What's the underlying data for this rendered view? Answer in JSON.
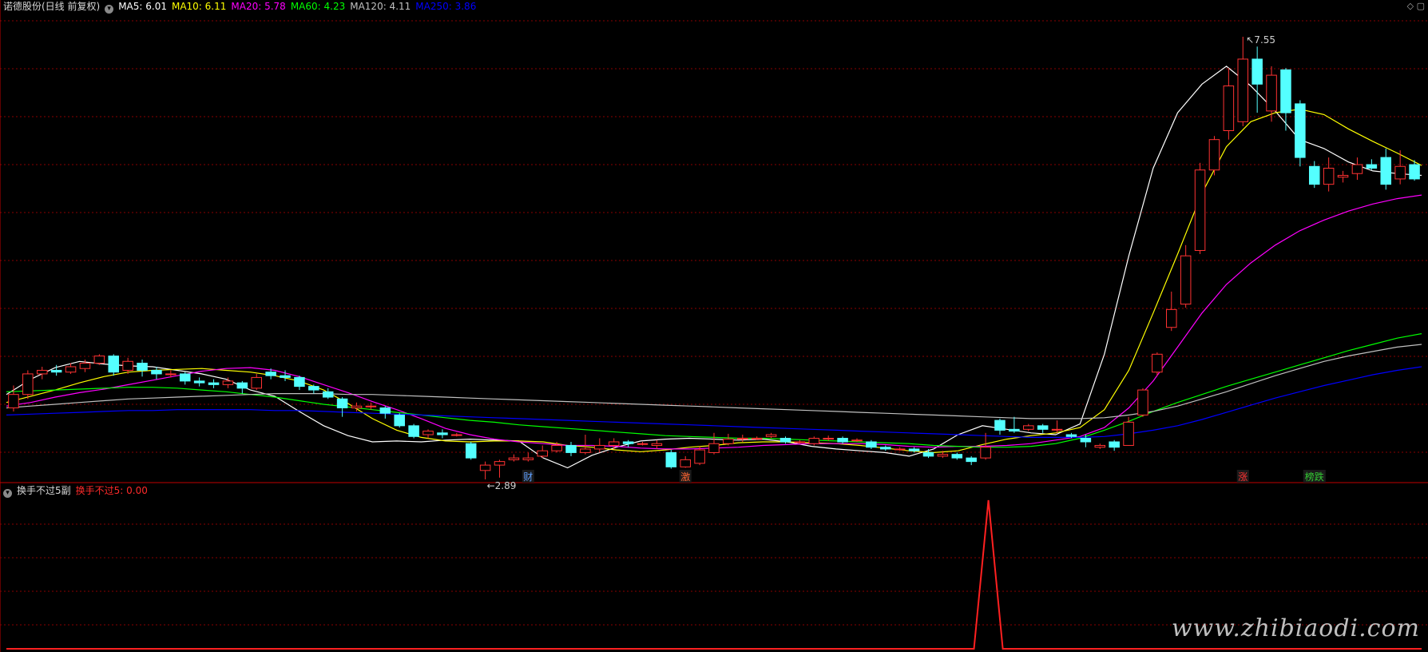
{
  "header": {
    "stock_title": "诺德股份(日线 前复权)",
    "ma_items": [
      {
        "label": "MA5: 6.01",
        "color": "#ffffff"
      },
      {
        "label": "MA10: 6.11",
        "color": "#ffff00"
      },
      {
        "label": "MA20: 5.78",
        "color": "#ff00ff"
      },
      {
        "label": "MA60: 4.23",
        "color": "#00ff00"
      },
      {
        "label": "MA120: 4.11",
        "color": "#c0c0c0"
      },
      {
        "label": "MA250: 3.86",
        "color": "#0000ff"
      }
    ]
  },
  "sub_header": {
    "indicator_name": "换手不过5副",
    "indicator_value": "换手不过5: 0.00",
    "value_color": "#ff2a2a"
  },
  "annotations": {
    "high_label": "7.55",
    "low_label": "2.89",
    "marks": [
      {
        "text": "财",
        "color": "#5fa0ff"
      },
      {
        "text": "激",
        "color": "#ff6633"
      },
      {
        "text": "涨",
        "color": "#ff3333"
      },
      {
        "text": "榜跌",
        "color": "#33cc33"
      }
    ]
  },
  "watermark": "www.zhibiaodi.com",
  "chart_data": [
    {
      "type": "candlestick",
      "title": "诺德股份(日线 前复权)",
      "ylim": [
        2.6,
        7.8
      ],
      "grid": true,
      "candles": [
        [
          3.4,
          3.55,
          3.65,
          3.36
        ],
        [
          3.55,
          3.78,
          3.82,
          3.5
        ],
        [
          3.78,
          3.82,
          3.86,
          3.72
        ],
        [
          3.82,
          3.8,
          3.88,
          3.76
        ],
        [
          3.8,
          3.86,
          3.9,
          3.78
        ],
        [
          3.84,
          3.9,
          3.94,
          3.8
        ],
        [
          3.9,
          3.98,
          4.0,
          3.88
        ],
        [
          3.98,
          3.8,
          4.0,
          3.76
        ],
        [
          3.82,
          3.92,
          3.96,
          3.78
        ],
        [
          3.9,
          3.82,
          3.94,
          3.75
        ],
        [
          3.82,
          3.78,
          3.86,
          3.72
        ],
        [
          3.78,
          3.78,
          3.82,
          3.74
        ],
        [
          3.78,
          3.7,
          3.8,
          3.66
        ],
        [
          3.7,
          3.68,
          3.74,
          3.64
        ],
        [
          3.68,
          3.66,
          3.72,
          3.62
        ],
        [
          3.66,
          3.7,
          3.74,
          3.62
        ],
        [
          3.68,
          3.62,
          3.7,
          3.56
        ],
        [
          3.62,
          3.74,
          3.78,
          3.6
        ],
        [
          3.8,
          3.76,
          3.84,
          3.72
        ],
        [
          3.76,
          3.74,
          3.82,
          3.7
        ],
        [
          3.74,
          3.64,
          3.76,
          3.6
        ],
        [
          3.64,
          3.6,
          3.66,
          3.56
        ],
        [
          3.58,
          3.52,
          3.62,
          3.5
        ],
        [
          3.5,
          3.4,
          3.52,
          3.3
        ],
        [
          3.4,
          3.42,
          3.46,
          3.36
        ],
        [
          3.42,
          3.42,
          3.46,
          3.38
        ],
        [
          3.4,
          3.34,
          3.42,
          3.28
        ],
        [
          3.32,
          3.2,
          3.34,
          3.18
        ],
        [
          3.2,
          3.08,
          3.22,
          3.06
        ],
        [
          3.1,
          3.14,
          3.16,
          3.06
        ],
        [
          3.12,
          3.1,
          3.16,
          3.06
        ],
        [
          3.1,
          3.1,
          3.12,
          3.08
        ],
        [
          3.0,
          2.84,
          3.02,
          2.82
        ],
        [
          2.7,
          2.76,
          2.8,
          2.6
        ],
        [
          2.76,
          2.8,
          2.82,
          2.62
        ],
        [
          2.82,
          2.84,
          2.88,
          2.8
        ],
        [
          2.82,
          2.84,
          2.9,
          2.8
        ],
        [
          2.86,
          2.92,
          2.98,
          2.84
        ],
        [
          2.92,
          2.98,
          3.02,
          2.9
        ],
        [
          2.98,
          2.9,
          3.02,
          2.86
        ],
        [
          2.9,
          2.94,
          3.1,
          2.88
        ],
        [
          2.94,
          2.98,
          3.06,
          2.9
        ],
        [
          2.98,
          3.02,
          3.06,
          2.94
        ],
        [
          3.02,
          3.0,
          3.04,
          2.96
        ],
        [
          3.0,
          3.0,
          3.02,
          2.98
        ],
        [
          2.98,
          3.0,
          3.04,
          2.94
        ],
        [
          2.9,
          2.74,
          2.93,
          2.72
        ],
        [
          2.74,
          2.82,
          2.86,
          2.73
        ],
        [
          2.78,
          2.93,
          2.97,
          2.76
        ],
        [
          2.9,
          3.0,
          3.12,
          2.88
        ],
        [
          3.0,
          3.05,
          3.11,
          2.98
        ],
        [
          3.05,
          3.06,
          3.1,
          3.02
        ],
        [
          3.06,
          3.06,
          3.08,
          3.04
        ],
        [
          3.08,
          3.1,
          3.12,
          3.06
        ],
        [
          3.06,
          3.02,
          3.08,
          3.0
        ],
        [
          3.02,
          3.02,
          3.04,
          3.0
        ],
        [
          3.0,
          3.06,
          3.08,
          2.98
        ],
        [
          3.06,
          3.06,
          3.09,
          3.03
        ],
        [
          3.06,
          3.02,
          3.08,
          3.0
        ],
        [
          3.04,
          3.04,
          3.06,
          3.02
        ],
        [
          3.02,
          2.96,
          3.04,
          2.94
        ],
        [
          2.96,
          2.94,
          2.98,
          2.92
        ],
        [
          2.94,
          2.94,
          2.96,
          2.92
        ],
        [
          2.94,
          2.92,
          2.96,
          2.9
        ],
        [
          2.9,
          2.86,
          2.94,
          2.84
        ],
        [
          2.86,
          2.88,
          2.92,
          2.84
        ],
        [
          2.88,
          2.84,
          2.9,
          2.82
        ],
        [
          2.84,
          2.8,
          2.86,
          2.76
        ],
        [
          2.84,
          2.96,
          3.12,
          2.82
        ],
        [
          3.26,
          3.15,
          3.28,
          3.1
        ],
        [
          3.16,
          3.14,
          3.3,
          3.12
        ],
        [
          3.16,
          3.2,
          3.22,
          3.14
        ],
        [
          3.2,
          3.16,
          3.22,
          3.12
        ],
        [
          3.16,
          3.16,
          3.26,
          3.12
        ],
        [
          3.1,
          3.08,
          3.12,
          3.06
        ],
        [
          3.06,
          3.02,
          3.1,
          2.96
        ],
        [
          2.96,
          2.98,
          3.0,
          2.94
        ],
        [
          3.02,
          2.96,
          3.04,
          2.92
        ],
        [
          2.98,
          3.24,
          3.3,
          2.98
        ],
        [
          3.32,
          3.6,
          3.62,
          3.3
        ],
        [
          3.8,
          4.0,
          4.02,
          3.76
        ],
        [
          4.3,
          4.5,
          4.7,
          4.26
        ],
        [
          4.56,
          5.1,
          5.22,
          4.52
        ],
        [
          5.16,
          6.06,
          6.14,
          5.12
        ],
        [
          6.06,
          6.4,
          6.44,
          6.0
        ],
        [
          6.5,
          7.0,
          7.2,
          6.4
        ],
        [
          6.6,
          7.3,
          7.55,
          6.55
        ],
        [
          7.3,
          7.02,
          7.44,
          6.7
        ],
        [
          6.72,
          7.12,
          7.22,
          6.6
        ],
        [
          7.18,
          6.7,
          7.2,
          6.5
        ],
        [
          6.8,
          6.2,
          6.84,
          6.1
        ],
        [
          6.1,
          5.9,
          6.16,
          5.86
        ],
        [
          5.9,
          6.08,
          6.2,
          5.82
        ],
        [
          5.98,
          6.0,
          6.05,
          5.92
        ],
        [
          6.02,
          6.12,
          6.2,
          5.95
        ],
        [
          6.12,
          6.08,
          6.18,
          6.06
        ],
        [
          6.2,
          5.9,
          6.3,
          5.84
        ],
        [
          5.96,
          6.1,
          6.28,
          5.9
        ],
        [
          6.12,
          5.96,
          6.17,
          5.94
        ]
      ],
      "ma_series": [
        {
          "name": "MA5",
          "values": [
            3.55,
            3.72,
            3.85,
            3.92,
            3.89,
            3.87,
            3.86,
            3.82,
            3.78,
            3.72,
            3.6,
            3.53,
            3.36,
            3.2,
            3.09,
            3.02,
            3.03,
            3.02,
            3.04,
            3.05,
            3.04,
            3.03,
            2.84,
            2.73,
            2.87,
            2.96,
            3.03,
            3.05,
            3.06,
            3.05,
            3.04,
            3.05,
            3.02,
            2.97,
            2.94,
            2.92,
            2.9,
            2.86,
            2.94,
            3.1,
            3.2,
            3.16,
            3.12,
            3.1,
            3.22,
            4.0,
            5.1,
            6.08,
            6.7,
            7.02,
            7.22,
            7.0,
            6.72,
            6.4,
            6.3,
            6.15,
            6.05,
            6.02,
            6.0
          ]
        },
        {
          "name": "MA10",
          "values": [
            3.46,
            3.53,
            3.6,
            3.68,
            3.75,
            3.8,
            3.82,
            3.83,
            3.84,
            3.82,
            3.8,
            3.76,
            3.7,
            3.6,
            3.45,
            3.28,
            3.15,
            3.07,
            3.03,
            3.02,
            3.03,
            3.03,
            3.02,
            2.98,
            2.96,
            2.93,
            2.91,
            2.93,
            2.96,
            2.98,
            3.01,
            3.02,
            3.02,
            3.01,
            3.0,
            2.98,
            2.95,
            2.92,
            2.9,
            2.92,
            2.99,
            3.05,
            3.09,
            3.12,
            3.18,
            3.38,
            3.82,
            4.46,
            5.12,
            5.8,
            6.32,
            6.6,
            6.7,
            6.74,
            6.68,
            6.52,
            6.38,
            6.25,
            6.11
          ]
        },
        {
          "name": "MA20",
          "values": [
            3.42,
            3.46,
            3.52,
            3.57,
            3.61,
            3.66,
            3.71,
            3.76,
            3.81,
            3.84,
            3.85,
            3.82,
            3.75,
            3.66,
            3.57,
            3.47,
            3.38,
            3.28,
            3.17,
            3.1,
            3.05,
            3.02,
            3.0,
            2.98,
            2.98,
            2.97,
            2.95,
            2.94,
            2.94,
            2.95,
            2.96,
            2.98,
            2.99,
            3.0,
            3.0,
            3.0,
            2.99,
            2.97,
            2.96,
            2.97,
            2.97,
            2.98,
            3.0,
            3.04,
            3.08,
            3.18,
            3.4,
            3.7,
            4.08,
            4.46,
            4.78,
            5.02,
            5.22,
            5.38,
            5.5,
            5.6,
            5.68,
            5.74,
            5.78
          ]
        },
        {
          "name": "MA60",
          "values": [
            3.58,
            3.59,
            3.6,
            3.61,
            3.62,
            3.63,
            3.63,
            3.62,
            3.6,
            3.58,
            3.55,
            3.52,
            3.48,
            3.44,
            3.41,
            3.38,
            3.35,
            3.32,
            3.29,
            3.26,
            3.24,
            3.21,
            3.19,
            3.17,
            3.15,
            3.13,
            3.11,
            3.09,
            3.08,
            3.07,
            3.06,
            3.06,
            3.05,
            3.04,
            3.03,
            3.02,
            3.01,
            3.0,
            2.98,
            2.97,
            2.96,
            2.96,
            2.97,
            3.0,
            3.06,
            3.15,
            3.25,
            3.36,
            3.46,
            3.55,
            3.64,
            3.72,
            3.8,
            3.88,
            3.96,
            4.04,
            4.11,
            4.18,
            4.23
          ]
        },
        {
          "name": "MA120",
          "values": [
            3.4,
            3.42,
            3.44,
            3.46,
            3.48,
            3.5,
            3.51,
            3.52,
            3.53,
            3.54,
            3.55,
            3.56,
            3.56,
            3.56,
            3.55,
            3.55,
            3.54,
            3.53,
            3.52,
            3.51,
            3.5,
            3.49,
            3.48,
            3.47,
            3.46,
            3.45,
            3.44,
            3.43,
            3.42,
            3.41,
            3.4,
            3.39,
            3.38,
            3.37,
            3.36,
            3.35,
            3.34,
            3.33,
            3.32,
            3.31,
            3.3,
            3.29,
            3.28,
            3.28,
            3.28,
            3.29,
            3.32,
            3.36,
            3.42,
            3.5,
            3.58,
            3.67,
            3.76,
            3.84,
            3.92,
            3.98,
            4.03,
            4.08,
            4.11
          ]
        },
        {
          "name": "MA250",
          "values": [
            3.32,
            3.33,
            3.34,
            3.35,
            3.36,
            3.37,
            3.37,
            3.38,
            3.38,
            3.38,
            3.38,
            3.37,
            3.37,
            3.36,
            3.35,
            3.34,
            3.33,
            3.32,
            3.31,
            3.3,
            3.29,
            3.28,
            3.27,
            3.26,
            3.25,
            3.24,
            3.23,
            3.22,
            3.21,
            3.2,
            3.19,
            3.18,
            3.17,
            3.16,
            3.15,
            3.14,
            3.13,
            3.12,
            3.11,
            3.1,
            3.09,
            3.08,
            3.07,
            3.07,
            3.07,
            3.08,
            3.11,
            3.15,
            3.2,
            3.27,
            3.35,
            3.43,
            3.51,
            3.58,
            3.65,
            3.71,
            3.77,
            3.82,
            3.86
          ]
        }
      ]
    },
    {
      "type": "line",
      "title": "换手不过5副",
      "series": [
        {
          "name": "换手不过5",
          "values": [
            0,
            0,
            0,
            0,
            0,
            0,
            0,
            0,
            0,
            0,
            0,
            0,
            0,
            0,
            0,
            0,
            0,
            0,
            0,
            0,
            0,
            0,
            0,
            0,
            0,
            0,
            0,
            0,
            0,
            0,
            0,
            0,
            0,
            0,
            0,
            0,
            0,
            0,
            0,
            0,
            0,
            0,
            0,
            0,
            0,
            0,
            0,
            0,
            0,
            0,
            0,
            0,
            0,
            0,
            0,
            0,
            0,
            0,
            0,
            0,
            0,
            0,
            0,
            0,
            0,
            0,
            0,
            0,
            1,
            0,
            0,
            0,
            0,
            0,
            0,
            0,
            0,
            0,
            0,
            0,
            0,
            0,
            0,
            0,
            0,
            0,
            0,
            0,
            0,
            0,
            0,
            0,
            0,
            0,
            0,
            0,
            0,
            0,
            0
          ]
        }
      ],
      "ylim": [
        0,
        1
      ]
    }
  ]
}
